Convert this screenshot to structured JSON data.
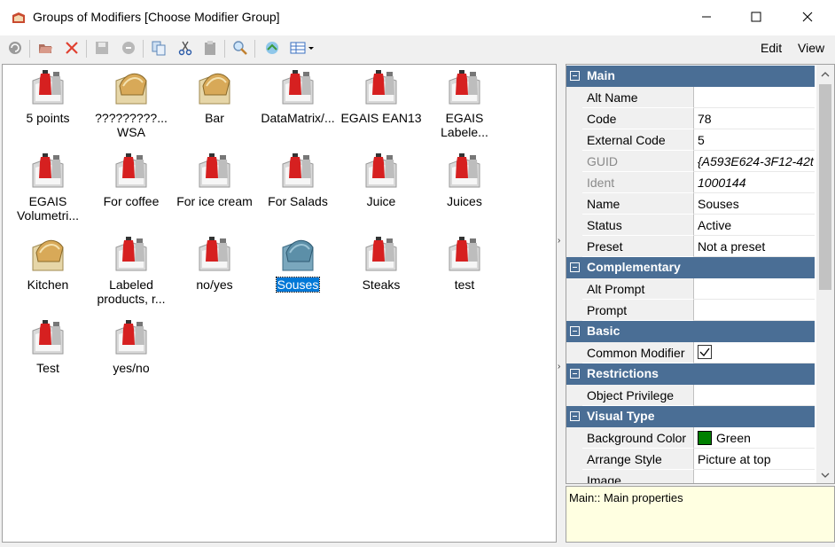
{
  "window": {
    "title": "Groups of Modifiers [Choose Modifier Group]",
    "controls": [
      "minimize-icon",
      "maximize-icon",
      "close-icon"
    ]
  },
  "menu": {
    "edit": "Edit",
    "view": "View"
  },
  "toolbar": {
    "buttons": [
      "refresh-icon",
      "open-folder-icon",
      "delete-icon",
      "save-icon",
      "undo-icon",
      "copy-icon",
      "cut-icon",
      "paste-icon",
      "find-icon",
      "sync-icon",
      "grid-view-icon"
    ]
  },
  "groups": [
    {
      "label": "5 points",
      "icon": "ketchup-group-icon"
    },
    {
      "label": "?????????...\nWSA",
      "icon": "pie-group-icon"
    },
    {
      "label": "Bar",
      "icon": "pie-group-icon"
    },
    {
      "label": "DataMatrix/...",
      "icon": "ketchup-group-icon"
    },
    {
      "label": "EGAIS EAN13",
      "icon": "ketchup-group-icon"
    },
    {
      "label": "EGAIS\nLabele...",
      "icon": "ketchup-group-icon"
    },
    {
      "label": "EGAIS\nVolumetri...",
      "icon": "ketchup-group-icon"
    },
    {
      "label": "For coffee",
      "icon": "ketchup-group-icon"
    },
    {
      "label": "For ice cream",
      "icon": "ketchup-group-icon"
    },
    {
      "label": "For Salads",
      "icon": "ketchup-group-icon"
    },
    {
      "label": "Juice",
      "icon": "ketchup-group-icon"
    },
    {
      "label": "Juices",
      "icon": "ketchup-group-icon"
    },
    {
      "label": "Kitchen",
      "icon": "pie-group-icon"
    },
    {
      "label": "Labeled\nproducts, r...",
      "icon": "ketchup-group-icon"
    },
    {
      "label": "no/yes",
      "icon": "ketchup-group-icon"
    },
    {
      "label": "Souses",
      "icon": "pie-group-icon",
      "selected": true
    },
    {
      "label": "Steaks",
      "icon": "ketchup-group-icon"
    },
    {
      "label": "test",
      "icon": "ketchup-group-icon"
    },
    {
      "label": "Test",
      "icon": "ketchup-group-icon"
    },
    {
      "label": "yes/no",
      "icon": "ketchup-group-icon"
    }
  ],
  "properties": {
    "main": {
      "title": "Main",
      "rows": [
        {
          "name": "Alt Name",
          "value": ""
        },
        {
          "name": "Code",
          "value": "78"
        },
        {
          "name": "External Code",
          "value": "5"
        },
        {
          "name": "GUID",
          "value": "{A593E624-3F12-42t",
          "readonly": true
        },
        {
          "name": "Ident",
          "value": "1000144",
          "readonly": true
        },
        {
          "name": "Name",
          "value": "Souses"
        },
        {
          "name": "Status",
          "value": "Active"
        },
        {
          "name": "Preset",
          "value": "Not a preset"
        }
      ]
    },
    "complementary": {
      "title": "Complementary",
      "rows": [
        {
          "name": "Alt Prompt",
          "value": ""
        },
        {
          "name": "Prompt",
          "value": ""
        }
      ]
    },
    "basic": {
      "title": "Basic",
      "rows": [
        {
          "name": "Common Modifier",
          "checked": true
        }
      ]
    },
    "restrictions": {
      "title": "Restrictions",
      "rows": [
        {
          "name": "Object Privilege",
          "value": ""
        }
      ]
    },
    "visual": {
      "title": "Visual Type",
      "rows": [
        {
          "name": "Background Color",
          "value": "Green",
          "color": "#008000"
        },
        {
          "name": "Arrange Style",
          "value": "Picture at top"
        },
        {
          "name": "Image",
          "value": ""
        }
      ]
    }
  },
  "help": {
    "text": "Main:: Main properties"
  },
  "colors": {
    "category": "#4a6e95",
    "selection": "#0078d7",
    "help_bg": "#ffffe1"
  }
}
